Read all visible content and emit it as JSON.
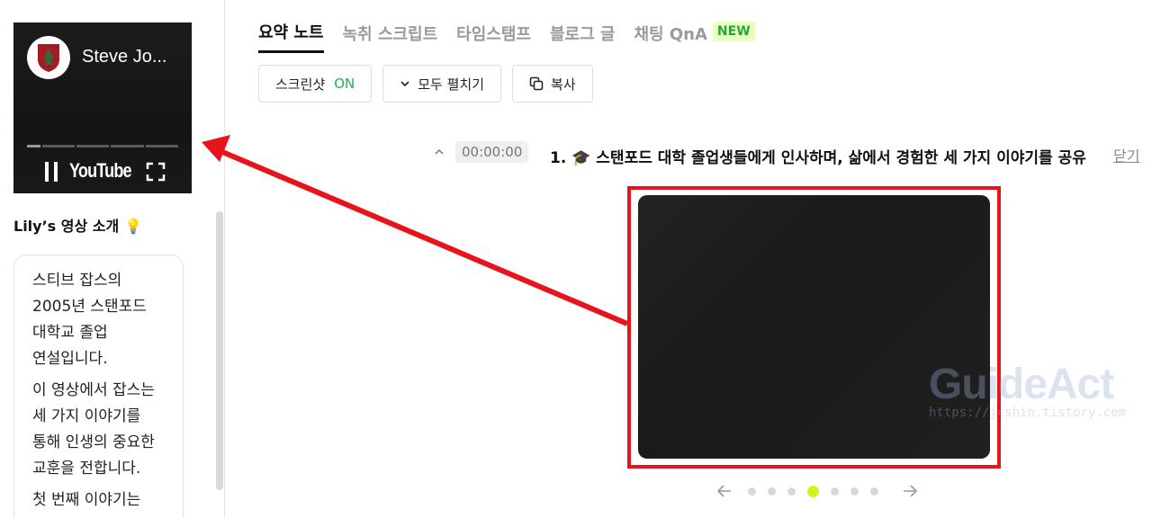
{
  "video": {
    "title": "Steve Jo...",
    "player_brand": "YouTube"
  },
  "intro": {
    "heading": "Lily’s 영상 소개",
    "paragraphs": [
      "스티브 잡스의 2005년 스탠포드 대학교 졸업 연설입니다.",
      "이 영상에서 잡스는 세 가지 이야기를 통해 인생의 중요한 교훈을 전합니다.",
      "첫 번째 이야기는"
    ]
  },
  "tabs": [
    {
      "label": "요약 노트",
      "active": true
    },
    {
      "label": "녹취 스크립트",
      "active": false
    },
    {
      "label": "타임스탬프",
      "active": false
    },
    {
      "label": "블로그 글",
      "active": false
    },
    {
      "label": "채팅 QnA",
      "active": false,
      "badge": "NEW"
    }
  ],
  "toolbar": {
    "screenshot_label": "스크린샷",
    "screenshot_state": "ON",
    "expand_label": "모두 펼치기",
    "copy_label": "복사"
  },
  "section": {
    "timestamp": "00:00:00",
    "title": "1. 🎓 스탠포드 대학 졸업생들에게 인사하며, 삶에서 경험한 세 가지 이야기를 공유",
    "close_label": "닫기"
  },
  "watermark": {
    "brand": "GuideAct",
    "url": "https://jcshin.tistory.com"
  },
  "carousel": {
    "total": 7,
    "current": 4
  },
  "colors": {
    "accent_green": "#22b24c",
    "highlight_red": "#e8141c",
    "active_dot": "#d7f218"
  }
}
